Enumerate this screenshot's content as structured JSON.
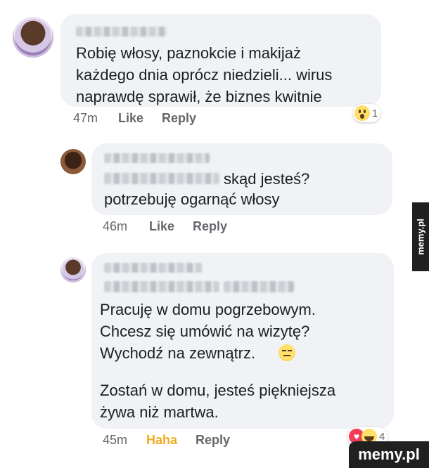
{
  "comments": [
    {
      "text": "Robię włosy, paznokcie i makijaż\nkażdego dnia oprócz niedzieli... wirus\nnaprawdę sprawił, że biznes kwitnie",
      "time": "47m",
      "like": "Like",
      "reply": "Reply",
      "reaction_count": "1"
    },
    {
      "inline_text": "skąd jesteś?",
      "text": "potrzebuję ogarnąć włosy",
      "time": "46m",
      "like": "Like",
      "reply": "Reply"
    },
    {
      "text": "Pracuję w domu pogrzebowym.\nChcesz się umówić na wizytę?\nWychodź na zewnątrz.",
      "text2": "Zostań w domu, jesteś piękniejsza\nżywa niż martwa.",
      "time": "45m",
      "like": "Haha",
      "reply": "Reply",
      "reaction_count": "4"
    }
  ],
  "watermark": "memy.pl",
  "colors": {
    "bubble": "#f0f2f5",
    "haha": "#f0ab1f",
    "meta": "#65676b"
  }
}
